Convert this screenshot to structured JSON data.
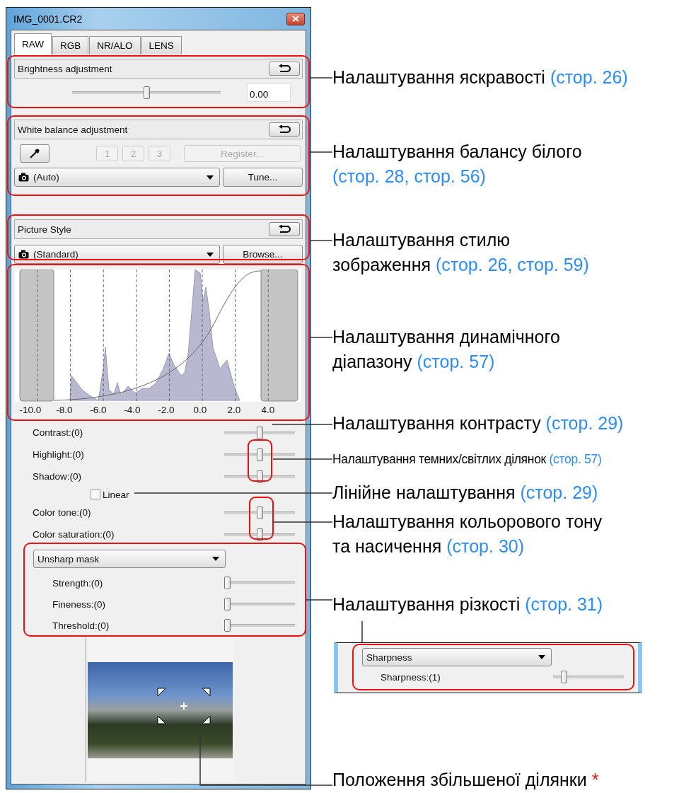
{
  "window": {
    "title": "IMG_0001.CR2"
  },
  "tabs": [
    {
      "label": "RAW",
      "selected": true
    },
    {
      "label": "RGB",
      "selected": false
    },
    {
      "label": "NR/ALO",
      "selected": false
    },
    {
      "label": "LENS",
      "selected": false
    }
  ],
  "brightness": {
    "title": "Brightness adjustment",
    "level": 0.5,
    "value": "0.00"
  },
  "white_balance": {
    "title": "White balance adjustment",
    "presets": [
      {
        "label": "1",
        "disabled": true
      },
      {
        "label": "2",
        "disabled": true
      },
      {
        "label": "3",
        "disabled": true
      }
    ],
    "register": {
      "label": "Register...",
      "disabled": true
    },
    "mode": "(Auto)",
    "tune": "Tune..."
  },
  "picture_style": {
    "title": "Picture Style",
    "style": "(Standard)",
    "browse": "Browse..."
  },
  "dynamic_range": {
    "axis_labels": [
      "-10.0",
      "-8.0",
      "-6.0",
      "-4.0",
      "-2.0",
      "0.0",
      "2.0",
      "4.0"
    ]
  },
  "adjustments": [
    {
      "kind": "slider",
      "label": "Contrast:(0)",
      "level": 0.5
    },
    {
      "kind": "slider",
      "label": "Highlight:(0)",
      "level": 0.5
    },
    {
      "kind": "slider",
      "label": "Shadow:(0)",
      "level": 0.5
    },
    {
      "kind": "checkbox",
      "label": "Linear",
      "checked": false
    },
    {
      "kind": "slider",
      "label": "Color tone:(0)",
      "level": 0.5
    },
    {
      "kind": "slider",
      "label": "Color saturation:(0)",
      "level": 0.5
    }
  ],
  "sharpness": {
    "mode": "Unsharp mask",
    "sliders": [
      {
        "label": "Strength:(0)",
        "level": 0
      },
      {
        "label": "Fineness:(0)",
        "level": 0
      },
      {
        "label": "Threshold:(0)",
        "level": 0
      }
    ]
  },
  "inset": {
    "mode": "Sharpness",
    "slider": {
      "label": "Sharpness:(1)",
      "level": 0.12
    }
  },
  "callouts": [
    {
      "kind": "normal",
      "text": "Налаштування яскравості",
      "ref": "(стор. 26)"
    },
    {
      "kind": "normal",
      "text": "Налаштування балансу білого",
      "ref": "(стор. 28, стор. 56)"
    },
    {
      "kind": "normal",
      "text": "Налаштування стилю зображення",
      "ref": "(стор. 26, стор. 59)"
    },
    {
      "kind": "normal",
      "text": "Налаштування динамічного діапазону",
      "ref": "(стор. 57)"
    },
    {
      "kind": "normal",
      "text": "Налаштування контрасту",
      "ref": "(стор. 29)"
    },
    {
      "kind": "compact",
      "text": "Налаштування темних/світлих ділянок",
      "ref": "(стор. 57)"
    },
    {
      "kind": "normal",
      "text": "Лінійне налаштування",
      "ref": "(стор. 29)"
    },
    {
      "kind": "normal",
      "text": "Налаштування кольорового тону та насичення",
      "ref": "(стор. 30)"
    },
    {
      "kind": "normal",
      "text": "Налаштування різкості",
      "ref": "(стор. 31)"
    },
    {
      "kind": "normal",
      "text": "Положення збільшеної ділянки",
      "mark": "*"
    }
  ]
}
